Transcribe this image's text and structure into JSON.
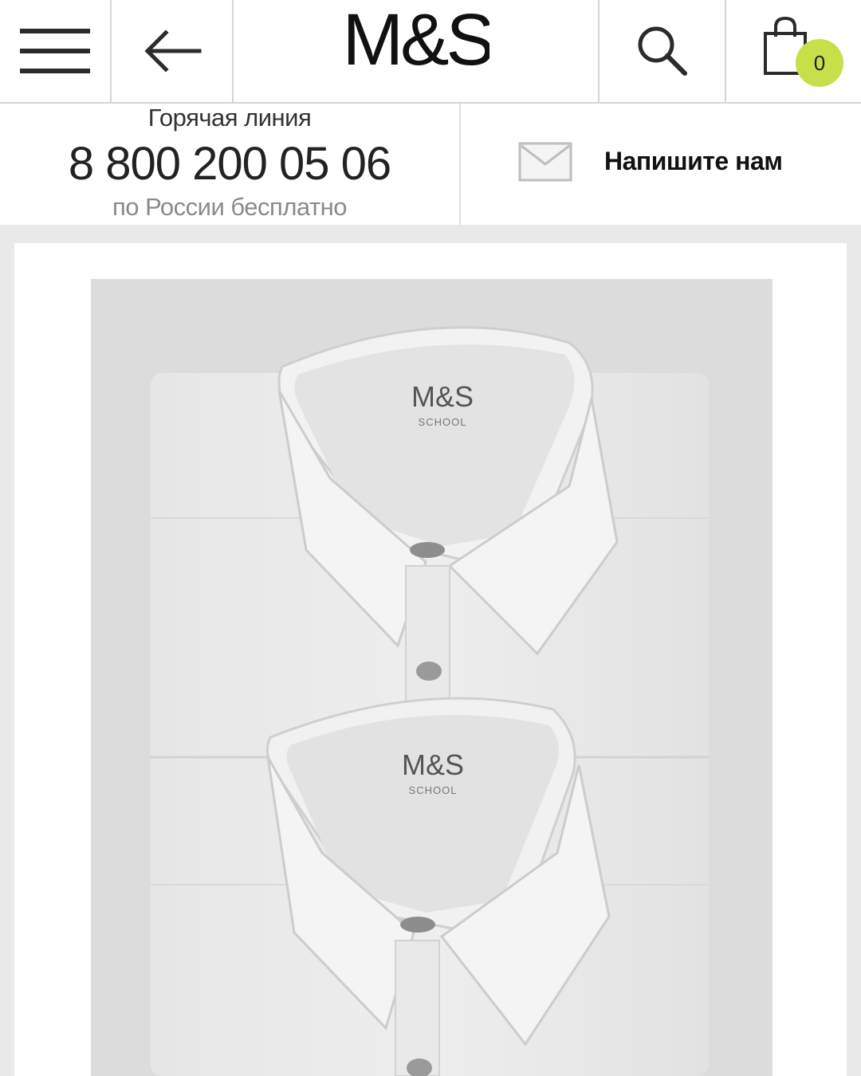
{
  "header": {
    "brand": "M&S",
    "cart_count": "0",
    "icons": {
      "menu": "hamburger-menu-icon",
      "back": "arrow-left-icon",
      "search": "search-icon",
      "cart": "shopping-bag-icon"
    }
  },
  "contact": {
    "hotline_title": "Горячая линия",
    "hotline_number": "8 800 200 05 06",
    "hotline_note": "по России бесплатно",
    "write_us_label": "Напишите нам",
    "mail_icon": "envelope-icon"
  },
  "product": {
    "image_labels": [
      {
        "brand": "M&S",
        "sub": "SCHOOL"
      },
      {
        "brand": "M&S",
        "sub": "SCHOOL"
      }
    ]
  },
  "colors": {
    "badge": "#c7e04a",
    "text": "#222222",
    "muted": "#8a8a8a",
    "background": "#e9e9e9"
  }
}
